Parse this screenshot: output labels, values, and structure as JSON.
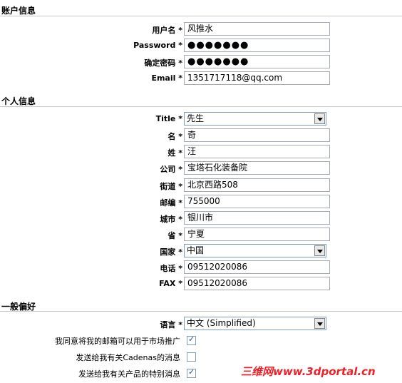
{
  "account": {
    "title": "账户信息",
    "username_label": "用户名",
    "username_value": "风推水",
    "password_label": "Password",
    "password_value": "●●●●●●●",
    "confirm_label": "确定密码",
    "confirm_value": "●●●●●●●",
    "email_label": "Email",
    "email_value": "1351717118@qq.com"
  },
  "personal": {
    "title": "个人信息",
    "title_label": "Title",
    "title_value": "先生",
    "firstname_label": "名",
    "firstname_value": "奇",
    "lastname_label": "姓",
    "lastname_value": "汪",
    "company_label": "公司",
    "company_value": "宝塔石化装备院",
    "street_label": "街道",
    "street_value": "北京西路508",
    "zip_label": "邮编",
    "zip_value": "755000",
    "city_label": "城市",
    "city_value": "银川市",
    "province_label": "省",
    "province_value": "宁夏",
    "country_label": "国家",
    "country_value": "中国",
    "phone_label": "电话",
    "phone_value": "09512020086",
    "fax_label": "FAX",
    "fax_value": "09512020086"
  },
  "prefs": {
    "title": "一般偏好",
    "language_label": "语言",
    "language_value": "中文 (Simplified)",
    "marketing_label": "我同意将我的邮箱可以用于市场推广",
    "marketing_checked": true,
    "cadenas_label": "发送给我有关Cadenas的消息",
    "cadenas_checked": false,
    "special_label": "发送给我有关产品的特别消息",
    "special_checked": true
  },
  "required_mark": "*",
  "watermark": "三维网www.3dportal.cn"
}
